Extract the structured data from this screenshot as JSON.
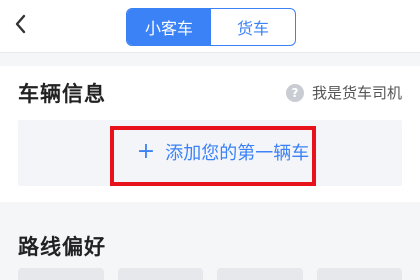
{
  "nav": {
    "back_icon": "chevron-left-icon",
    "tabs": [
      {
        "label": "小客车",
        "active": true
      },
      {
        "label": "货车",
        "active": false
      }
    ]
  },
  "vehicle_info": {
    "title": "车辆信息",
    "help_icon": "question-circle-icon",
    "driver_link_label": "我是货车司机",
    "add_vehicle_label": "添加您的第一辆车",
    "add_icon": "plus-icon",
    "highlight_color": "#e8131a"
  },
  "route_preference": {
    "title": "路线偏好"
  },
  "colors": {
    "accent": "#3b82f6",
    "page_background": "#f5f6f8",
    "card_background": "#f4f5f8",
    "text_primary": "#222222"
  }
}
